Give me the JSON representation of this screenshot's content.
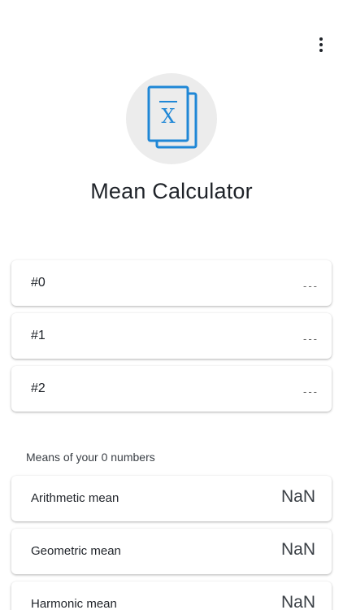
{
  "header": {
    "menu_icon": "more-vert-icon",
    "logo_icon": "mean-formula-document-icon",
    "logo_glyph": "X",
    "title": "Mean Calculator"
  },
  "inputs": [
    {
      "label": "#0",
      "value": "---"
    },
    {
      "label": "#1",
      "value": "---"
    },
    {
      "label": "#2",
      "value": "---"
    }
  ],
  "results": {
    "section_label": "Means of your 0 numbers",
    "items": [
      {
        "label": "Arithmetic mean",
        "value": "NaN"
      },
      {
        "label": "Geometric mean",
        "value": "NaN"
      },
      {
        "label": "Harmonic mean",
        "value": "NaN"
      }
    ]
  },
  "colors": {
    "accent": "#1f87d6",
    "logo_background": "#ececec",
    "text": "#1f2329"
  }
}
